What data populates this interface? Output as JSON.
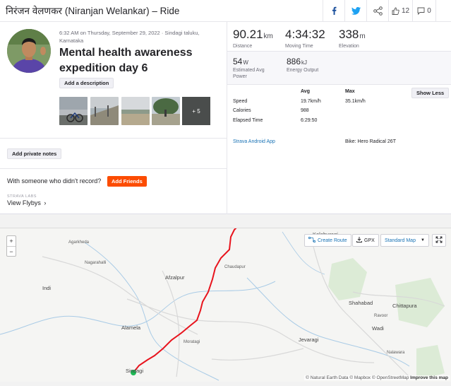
{
  "header": {
    "title": "निरंजन वेलणकर (Niranjan Welankar) – Ride",
    "kudos_count": "12",
    "comment_count": "0"
  },
  "activity": {
    "meta": "6:32 AM on Thursday, September 29, 2022 · Sindagi taluku, Karnataka",
    "title": "Mental health awareness expedition day 6",
    "add_description": "Add a description",
    "more_photos": "+ 5",
    "add_notes": "Add private notes",
    "someone_text": "With someone who didn't record?",
    "add_friends": "Add Friends",
    "labs_label": "STRAVA LABS",
    "flyby_label": "View Flybys"
  },
  "stats": {
    "distance": {
      "value": "90.21",
      "unit": "km",
      "label": "Distance"
    },
    "moving_time": {
      "value": "4:34:32",
      "label": "Moving Time"
    },
    "elevation": {
      "value": "338",
      "unit": "m",
      "label": "Elevation"
    },
    "power": {
      "value": "54",
      "unit": "W",
      "label": "Estimated Avg Power"
    },
    "energy": {
      "value": "886",
      "unit": "kJ",
      "label": "Energy Output"
    },
    "table": {
      "col_avg": "Avg",
      "col_max": "Max",
      "show_less": "Show Less",
      "rows": [
        {
          "label": "Speed",
          "avg": "19.7km/h",
          "max": "35.1km/h"
        },
        {
          "label": "Calories",
          "avg": "988",
          "max": ""
        },
        {
          "label": "Elapsed Time",
          "avg": "6:29:50",
          "max": ""
        }
      ]
    },
    "device": "Strava Android App",
    "bike": "Bike: Hero Radical 26T"
  },
  "map": {
    "zoom_in": "+",
    "zoom_out": "−",
    "create_route": "Create Route",
    "gpx": "GPX",
    "map_type": "Standard Map",
    "attribution": "© Natural Earth Data © Mapbox © OpenStreetMap",
    "improve": "Improve this map",
    "places": {
      "kalaburagi": "Kalaburagi",
      "agarkheda": "Agarkheda",
      "nagarahalli": "Nagarahalli",
      "indi": "Indi",
      "afzalpur": "Afzalpur",
      "chaudapur": "Chaudapur",
      "alamela": "Alamela",
      "moraтagi": "Moratagi",
      "sindagi": "Sindagi",
      "shahabad": "Shahabad",
      "chittapura": "Chittapura",
      "ravoor": "Ravoor",
      "wadi": "Wadi",
      "jevaragi": "Jevaragi",
      "nalawara": "Nalawara"
    }
  },
  "colors": {
    "brand": "#fc4c02",
    "link": "#1a73b5",
    "route": "#e8141d",
    "start": "#1db954"
  }
}
